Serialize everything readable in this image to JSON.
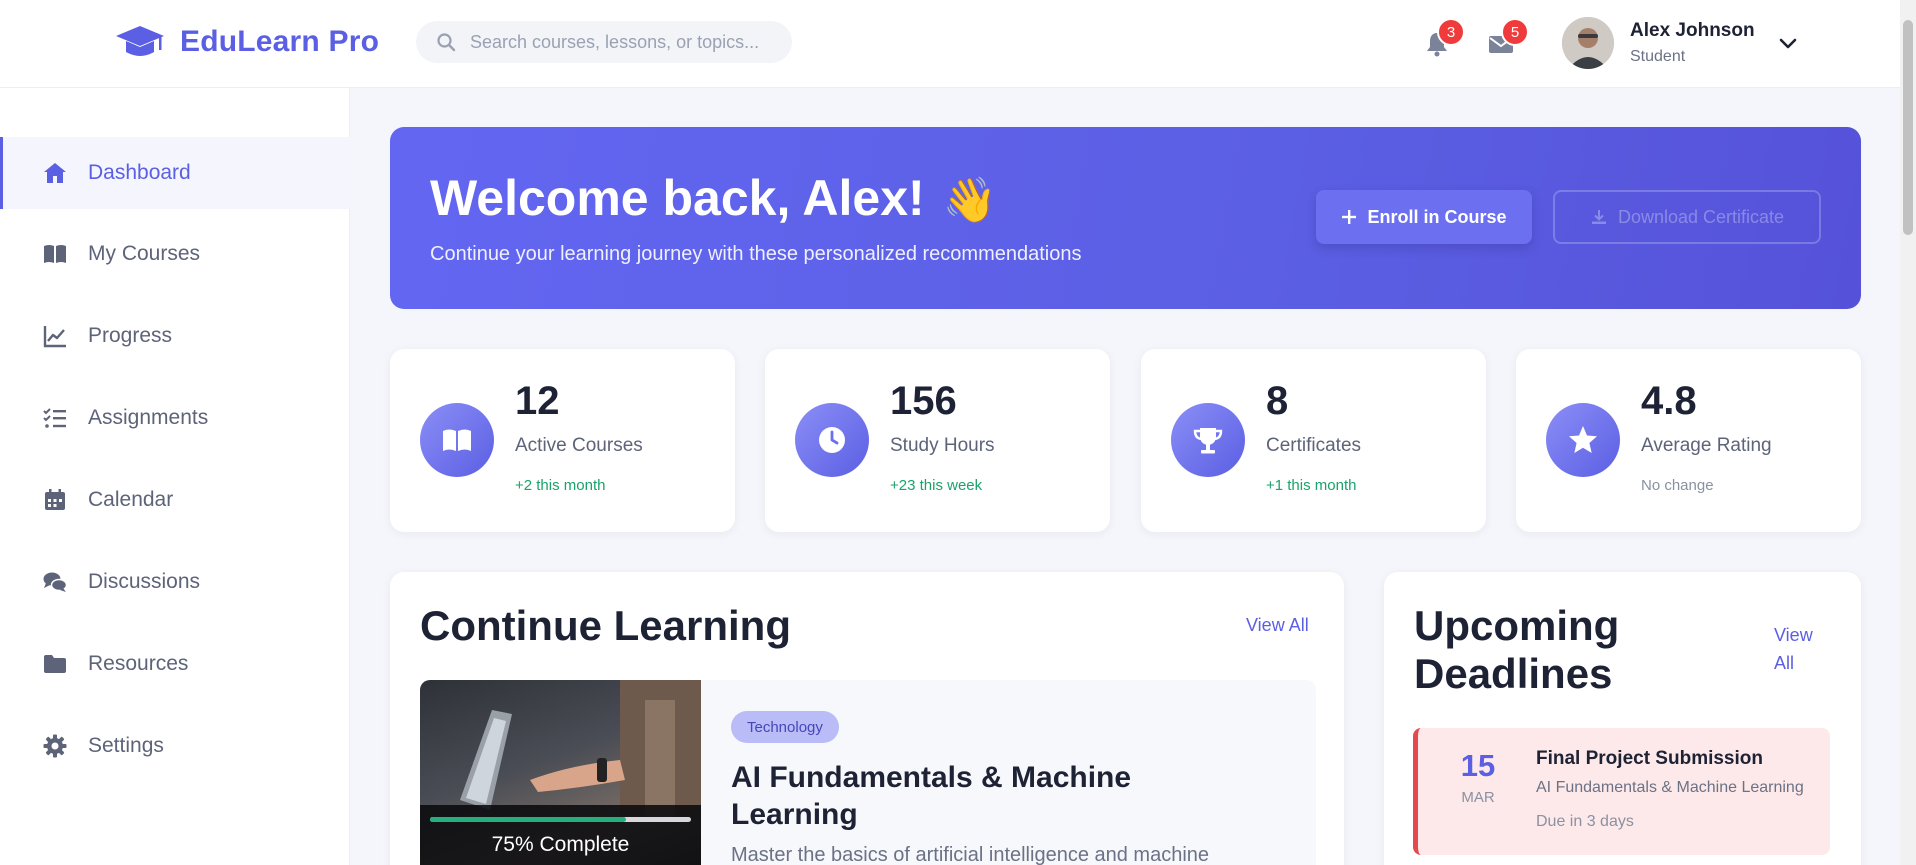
{
  "app": {
    "name": "EduLearn Pro",
    "search_placeholder": "Search courses, lessons, or topics..."
  },
  "header": {
    "notifications_count": "3",
    "messages_count": "5",
    "user_name": "Alex Johnson",
    "user_role": "Student"
  },
  "sidebar": {
    "items": [
      {
        "label": "Dashboard",
        "icon": "home-icon",
        "active": true
      },
      {
        "label": "My Courses",
        "icon": "book-open-icon"
      },
      {
        "label": "Progress",
        "icon": "line-chart-icon"
      },
      {
        "label": "Assignments",
        "icon": "tasks-icon"
      },
      {
        "label": "Calendar",
        "icon": "calendar-icon"
      },
      {
        "label": "Discussions",
        "icon": "comments-icon"
      },
      {
        "label": "Resources",
        "icon": "folder-icon"
      },
      {
        "label": "Settings",
        "icon": "gear-icon"
      }
    ]
  },
  "hero": {
    "title": "Welcome back, Alex!",
    "wave": "👋",
    "subtitle": "Continue your learning journey with these personalized recommendations",
    "enroll_label": "Enroll in Course",
    "download_label": "Download Certificate"
  },
  "stats": [
    {
      "value": "12",
      "label": "Active Courses",
      "change": "+2 this month",
      "icon": "book-open-icon"
    },
    {
      "value": "156",
      "label": "Study Hours",
      "change": "+23 this week",
      "icon": "clock-icon"
    },
    {
      "value": "8",
      "label": "Certificates",
      "change": "+1 this month",
      "icon": "trophy-icon"
    },
    {
      "value": "4.8",
      "label": "Average Rating",
      "change": "No change",
      "icon": "star-icon"
    }
  ],
  "continue_learning": {
    "title": "Continue Learning",
    "view_all": "View All",
    "course": {
      "progress_percent": 75,
      "progress_text": "75% Complete",
      "tag": "Technology",
      "title": "AI Fundamentals & Machine Learning",
      "description": "Master the basics of artificial intelligence and machine"
    }
  },
  "deadlines": {
    "title": "Upcoming Deadlines",
    "view_all": "View All",
    "items": [
      {
        "day": "15",
        "month": "MAR",
        "title": "Final Project Submission",
        "course": "AI Fundamentals & Machine Learning",
        "due": "Due in 3 days"
      }
    ]
  },
  "colors": {
    "accent": "#5b5fe3",
    "positive": "#1aa36a",
    "alert": "#e5484d"
  }
}
